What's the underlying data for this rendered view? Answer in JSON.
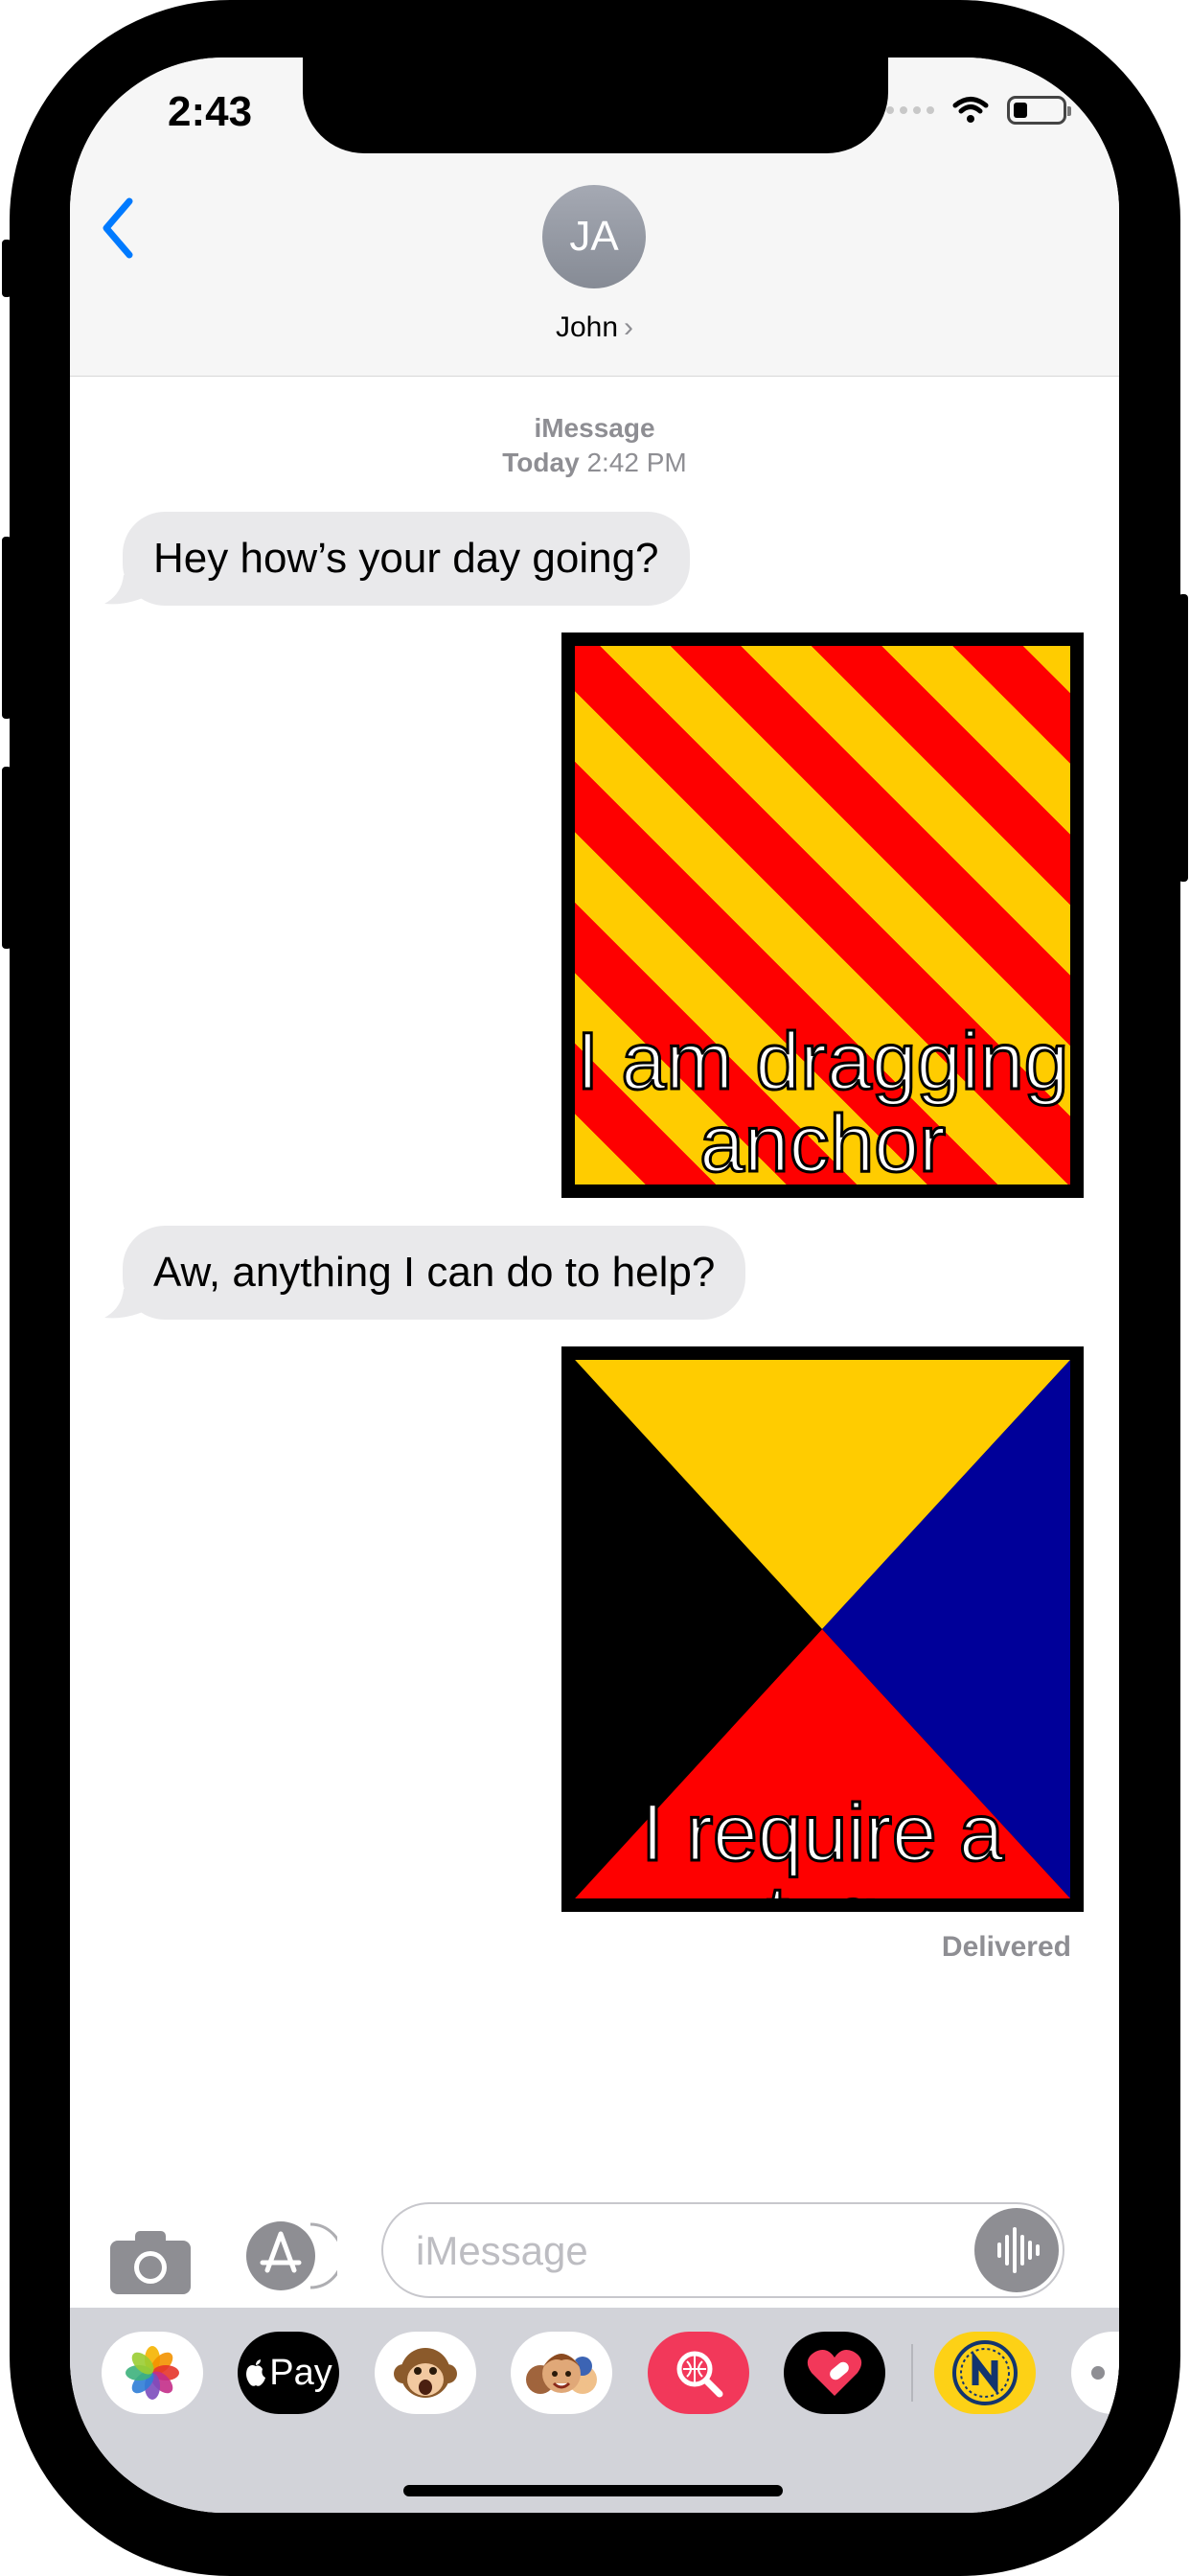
{
  "status_bar": {
    "time": "2:43"
  },
  "contact": {
    "initials": "JA",
    "name": "John",
    "chevron": "›"
  },
  "conversation": {
    "service": "iMessage",
    "date_label": "Today",
    "time_label": "2:42 PM",
    "messages": [
      {
        "type": "text",
        "from": "them",
        "text": "Hey how’s your day going?"
      },
      {
        "type": "image",
        "from": "me",
        "flag": "signal-flag-Y",
        "caption_line1": "I am dragging",
        "caption_line2": "anchor"
      },
      {
        "type": "text",
        "from": "them",
        "text": "Aw, anything I can do to help?"
      },
      {
        "type": "image",
        "from": "me",
        "flag": "signal-flag-Z",
        "caption": "I require a tug"
      }
    ],
    "delivery_status": "Delivered"
  },
  "composer": {
    "placeholder": "iMessage"
  },
  "app_drawer": {
    "apple_pay_label": "Pay",
    "apps": [
      "photos-icon",
      "apple-pay-icon",
      "monkey-animoji-icon",
      "memoji-icon",
      "image-search-icon",
      "heart-sticker-icon",
      "n-app-icon",
      "more-icon"
    ]
  },
  "colors": {
    "accent": "#007aff",
    "flag_red": "#fe0000",
    "flag_yellow": "#ffcc00",
    "flag_blue": "#000099"
  }
}
